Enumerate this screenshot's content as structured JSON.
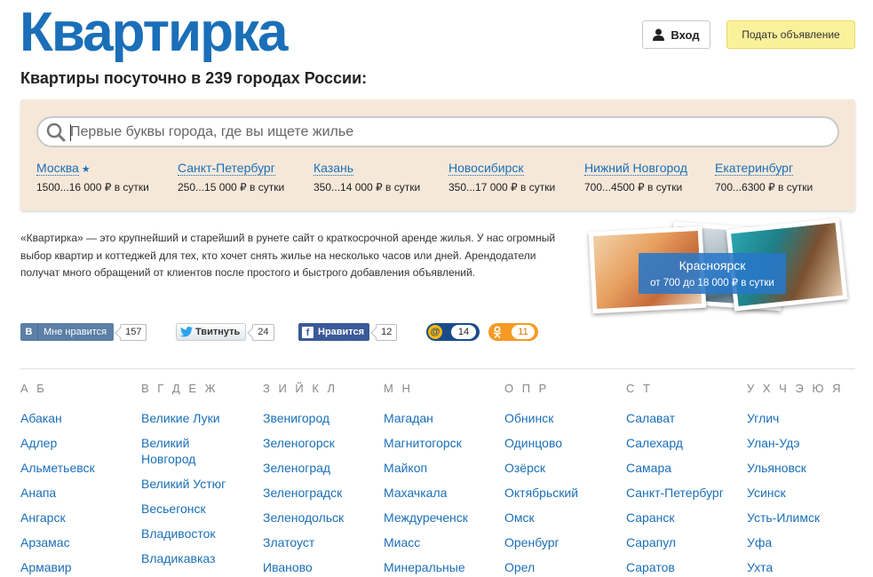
{
  "header": {
    "logo": "Квартирка",
    "login_label": "Вход",
    "post_label": "Подать объявление"
  },
  "headline": "Квартиры посуточно в 239 городах России:",
  "search": {
    "placeholder": "Первые буквы города, где вы ищете жилье"
  },
  "popular": [
    {
      "name": "Москва",
      "price": "1500...16 000 ₽ в сутки",
      "star": "★"
    },
    {
      "name": "Санкт-Петербург",
      "price": "250...15 000 ₽ в сутки"
    },
    {
      "name": "Казань",
      "price": "350...14 000 ₽ в сутки"
    },
    {
      "name": "Новосибирск",
      "price": "350...17 000 ₽ в сутки"
    },
    {
      "name": "Нижний Новгород",
      "price": "700...4500 ₽ в сутки"
    },
    {
      "name": "Екатеринбург",
      "price": "700...6300 ₽ в сутки"
    }
  ],
  "about": "«Квартирка» — это крупнейший и старейший в рунете сайт о краткосрочной аренде жилья. У нас огромный выбор квартир и коттеджей для тех, кто хочет снять жилье на несколько часов или дней. Арендодатели получат много обращений от клиентов после простого и быстрого добавления объявлений.",
  "featured": {
    "city": "Красноярск",
    "price": "от 700 до 18 000 ₽ в сутки"
  },
  "social": {
    "vk_icon": "В",
    "vk_label": "Мне нравится",
    "vk_count": "157",
    "tw_label": "Твитнуть",
    "tw_count": "24",
    "fb_label": "Нравится",
    "fb_count": "12",
    "mail_icon": "@",
    "mail_count": "14",
    "ok_count": "11"
  },
  "columns": [
    {
      "letters": "А Б",
      "cities": [
        "Абакан",
        "Адлер",
        "Альметьевск",
        "Анапа",
        "Ангарск",
        "Арзамас",
        "Армавир"
      ]
    },
    {
      "letters": "В Г Д Е Ж",
      "cities": [
        "Великие Луки",
        "Великий Новгород",
        "Великий Устюг",
        "Весьегонск",
        "Владивосток",
        "Владикавказ"
      ]
    },
    {
      "letters": "З И Й К Л",
      "cities": [
        "Звенигород",
        "Зеленогорск",
        "Зеленоград",
        "Зеленоградск",
        "Зеленодольск",
        "Златоуст",
        "Иваново"
      ]
    },
    {
      "letters": "М Н",
      "cities": [
        "Магадан",
        "Магнитогорск",
        "Майкоп",
        "Махачкала",
        "Междуреченск",
        "Миасс",
        "Минеральные"
      ]
    },
    {
      "letters": "О П Р",
      "cities": [
        "Обнинск",
        "Одинцово",
        "Озёрск",
        "Октябрьский",
        "Омск",
        "Оренбург",
        "Орел"
      ]
    },
    {
      "letters": "С Т",
      "cities": [
        "Салават",
        "Салехард",
        "Самара",
        "Санкт-Петербург",
        "Саранск",
        "Сарапул",
        "Саратов"
      ]
    },
    {
      "letters": "У Х Ч Э Ю Я",
      "cities": [
        "Углич",
        "Улан-Удэ",
        "Ульяновск",
        "Усинск",
        "Усть-Илимск",
        "Уфа",
        "Ухта"
      ]
    }
  ]
}
